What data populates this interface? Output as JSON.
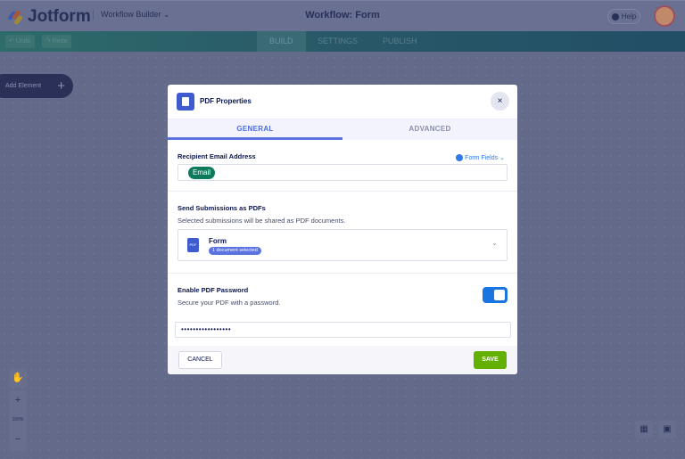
{
  "header": {
    "brand": "Jotform",
    "product": "Workflow Builder",
    "title": "Workflow: Form",
    "help": "Help"
  },
  "toolbar": {
    "undo": "Undo",
    "redo": "Redo",
    "tabs": [
      "BUILD",
      "SETTINGS",
      "PUBLISH"
    ],
    "active_tab": "BUILD"
  },
  "canvas": {
    "add_element": "Add Element",
    "zoom": "100%",
    "plus": "+",
    "minus": "−"
  },
  "modal": {
    "title": "PDF Properties",
    "close": "×",
    "tabs": [
      "GENERAL",
      "ADVANCED"
    ],
    "active_tab": "GENERAL",
    "recipient": {
      "label": "Recipient Email Address",
      "form_fields": "Form Fields",
      "chip": "Email"
    },
    "send": {
      "label": "Send Submissions as PDFs",
      "description": "Selected submissions will be shared as PDF documents.",
      "form": "Form",
      "badge": "1 document selected",
      "pdf_icon": "PDF"
    },
    "password": {
      "label": "Enable PDF Password",
      "description": "Secure your PDF with a password.",
      "enabled": true,
      "value": "•••••••••••••••••"
    },
    "cancel": "CANCEL",
    "save": "SAVE"
  },
  "colors": {
    "accent": "#5a73e0",
    "save": "#63b000",
    "chip": "#0e7a5c",
    "toggle": "#1a75e0"
  }
}
